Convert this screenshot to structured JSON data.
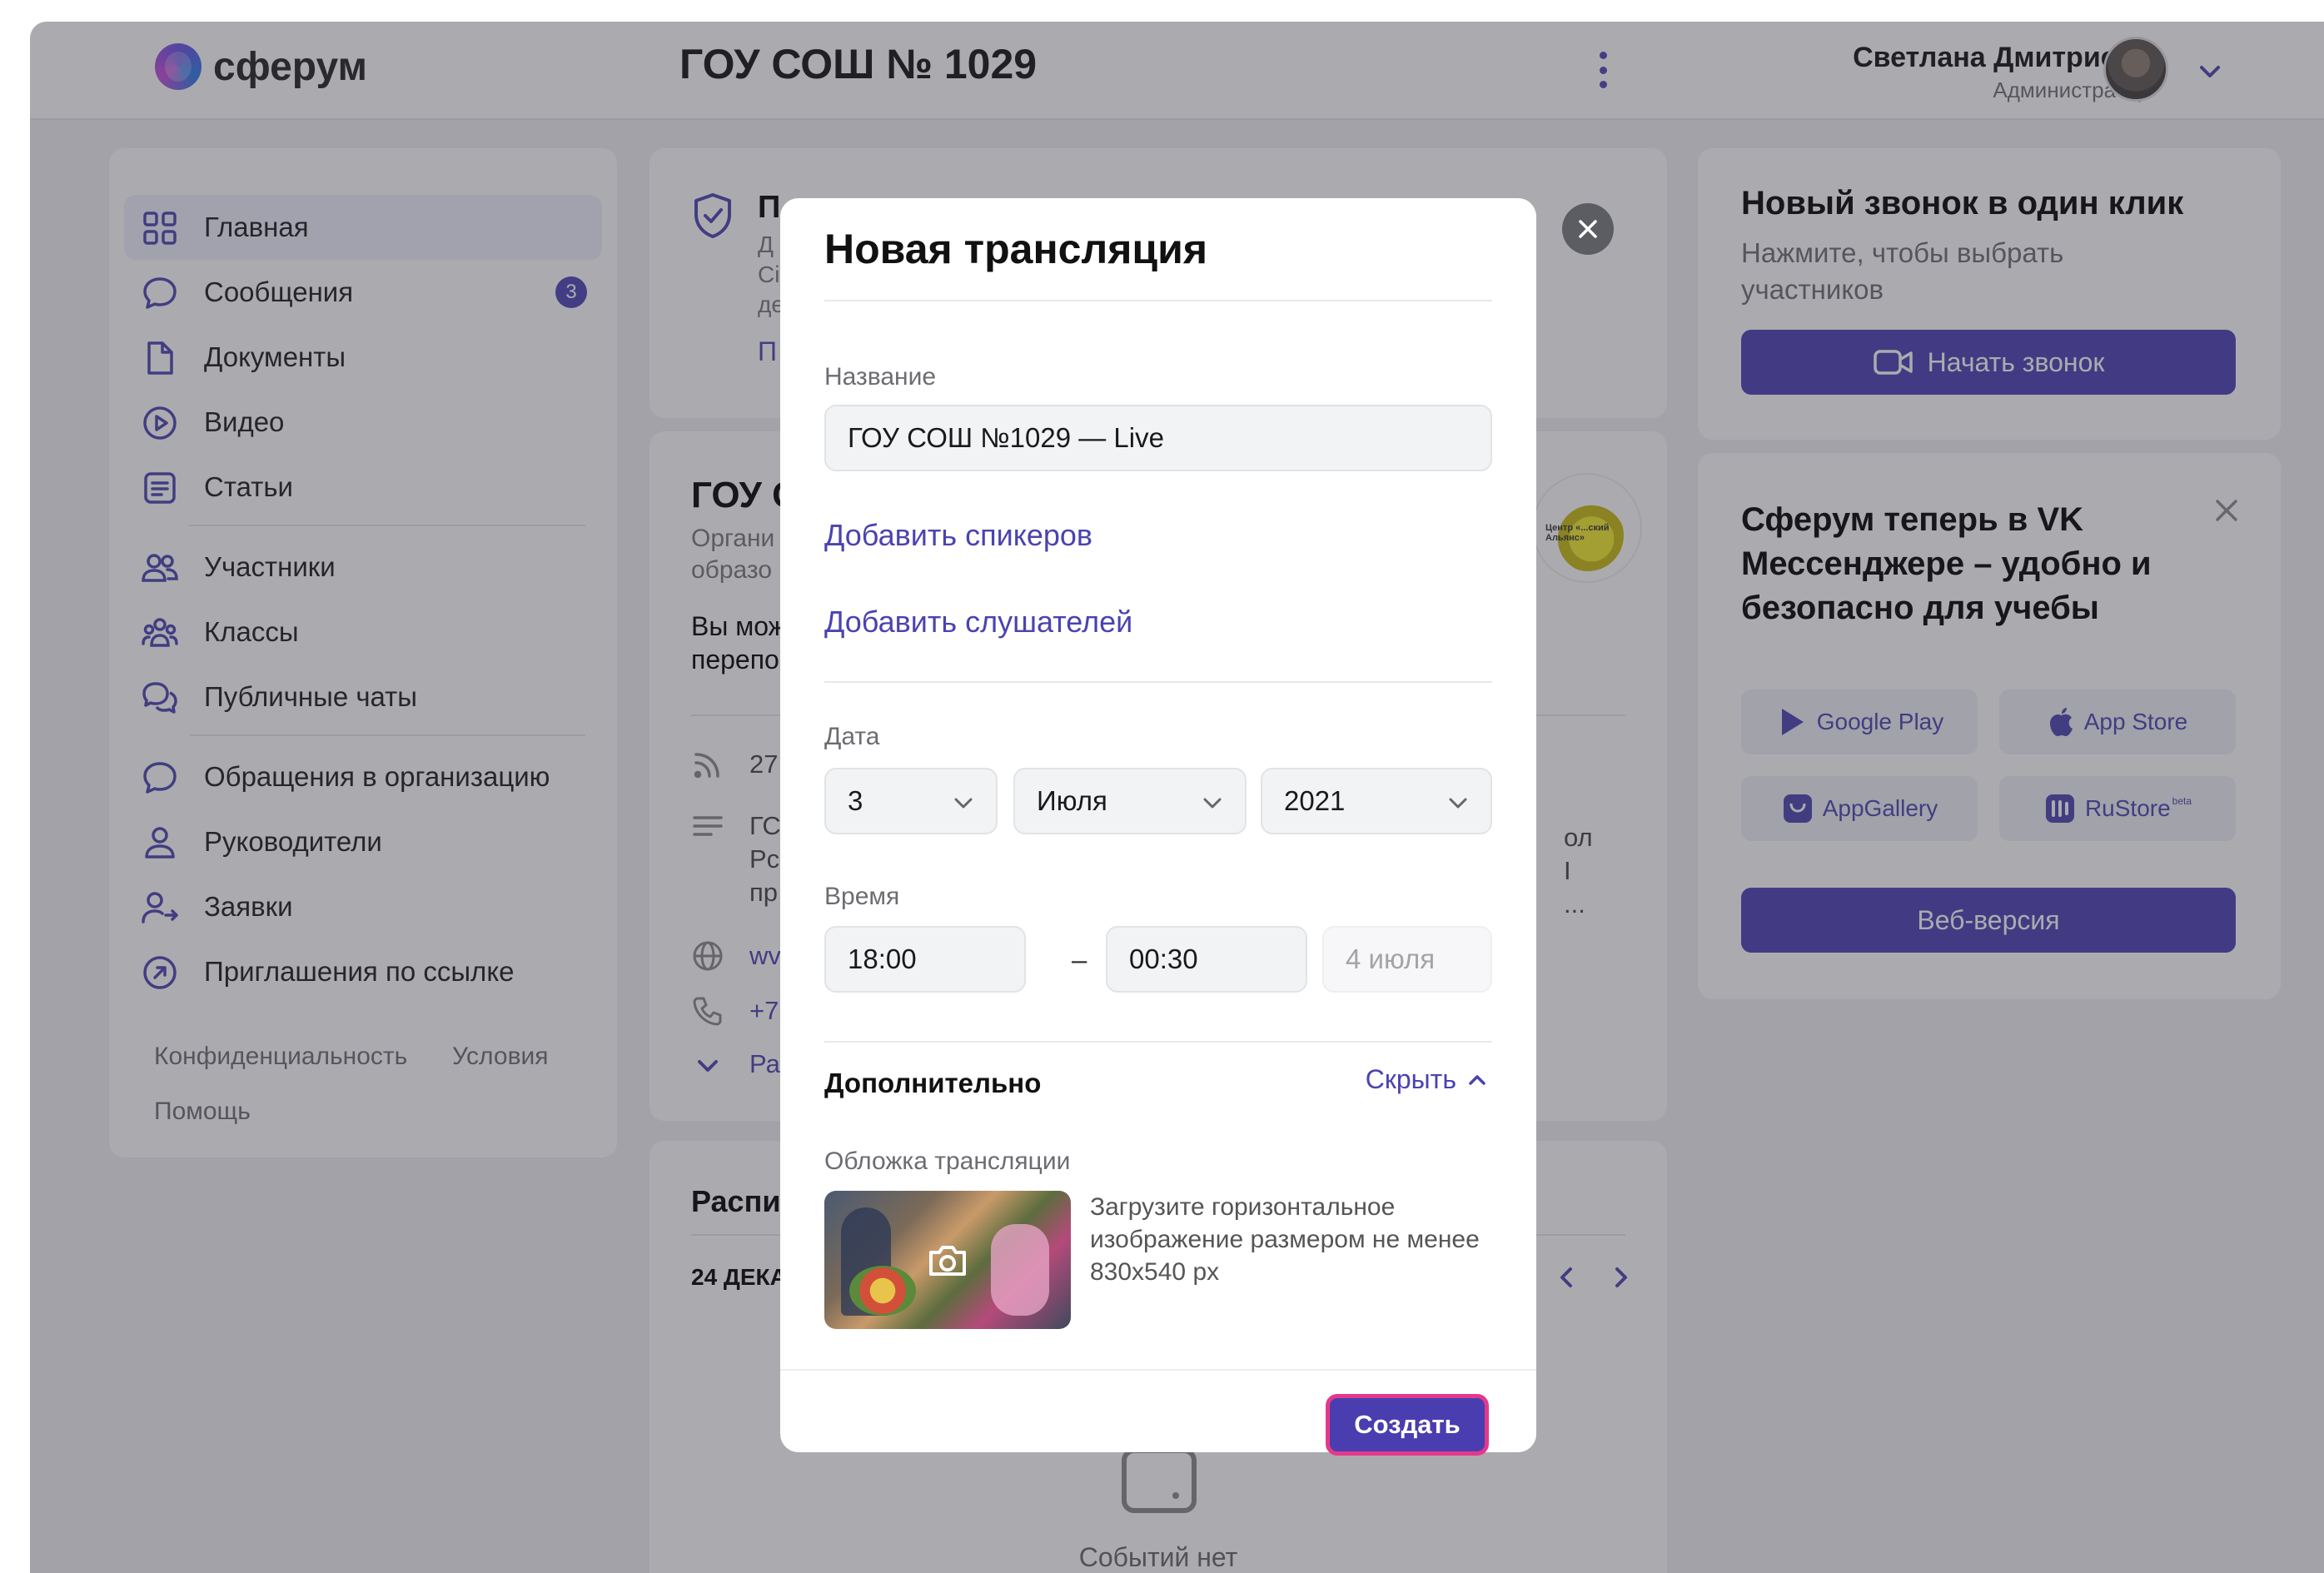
{
  "header": {
    "logo_text": "сферум",
    "org_title": "ГОУ СОШ № 1029",
    "user_name": "Светлана Дмитриева",
    "user_role": "Администратор"
  },
  "sidebar": {
    "items": [
      {
        "label": "Главная",
        "icon": "grid-icon"
      },
      {
        "label": "Сообщения",
        "icon": "chat-icon",
        "badge": "3"
      },
      {
        "label": "Документы",
        "icon": "document-icon"
      },
      {
        "label": "Видео",
        "icon": "play-icon"
      },
      {
        "label": "Статьи",
        "icon": "article-icon"
      },
      {
        "label": "Участники",
        "icon": "people-icon"
      },
      {
        "label": "Классы",
        "icon": "group-icon"
      },
      {
        "label": "Публичные чаты",
        "icon": "chats-icon"
      },
      {
        "label": "Обращения в организацию",
        "icon": "chat-icon"
      },
      {
        "label": "Руководители",
        "icon": "person-icon"
      },
      {
        "label": "Заявки",
        "icon": "person-arrow-icon"
      },
      {
        "label": "Приглашения по ссылке",
        "icon": "link-arrow-icon"
      }
    ],
    "footer": {
      "privacy": "Конфиденциальность",
      "terms": "Условия",
      "help": "Помощь"
    }
  },
  "background": {
    "card1_title_fragment": "П",
    "card1_lines": [
      "Д",
      "Сі",
      "де"
    ],
    "card1_link": "П",
    "card2_title_fragment": "ГОУ С",
    "card2_sub": [
      "Органи",
      "образо"
    ],
    "card2_text": [
      "Вы мож",
      "перепо"
    ],
    "card2_count": "27",
    "card2_desc": [
      "ГС",
      "Рс",
      "пр"
    ],
    "card2_site": "wv",
    "card2_phone": "+7",
    "card2_more": "Ра",
    "card2_right_text": [
      "ол",
      "І",
      "..."
    ],
    "logo_caption": "Центр «...ский Альянс»",
    "schedule_title": "Распис",
    "schedule_date": "24 ДЕКА",
    "no_events": "Событий нет"
  },
  "right_panel": {
    "call_title": "Новый звонок в один клик",
    "call_sub": "Нажмите, чтобы выбрать участников",
    "call_button": "Начать звонок",
    "promo_title": "Сферум теперь в VK Мессенджере – удобно и безопасно для учебы",
    "stores": [
      "Google Play",
      "App Store",
      "AppGallery",
      "RuStore"
    ],
    "rustore_beta": "beta",
    "web_button": "Веб-версия"
  },
  "modal": {
    "title": "Новая трансляция",
    "name_label": "Название",
    "name_value": "ГОУ СОШ №1029 — Live",
    "add_speakers": "Добавить спикеров",
    "add_listeners": "Добавить слушателей",
    "date_label": "Дата",
    "day": "3",
    "month": "Июля",
    "year": "2021",
    "time_label": "Время",
    "time_start": "18:00",
    "time_dash": "–",
    "time_end": "00:30",
    "end_date": "4 июля",
    "extra_title": "Дополнительно",
    "hide_link": "Скрыть",
    "cover_label": "Обложка трансляции",
    "cover_hint": "Загрузите горизонтальное изображение размером не менее 830х540 px",
    "create_button": "Создать"
  },
  "colors": {
    "accent": "#4a3fb4",
    "highlight_border": "#e4398b",
    "badge": "#4d43b8"
  }
}
